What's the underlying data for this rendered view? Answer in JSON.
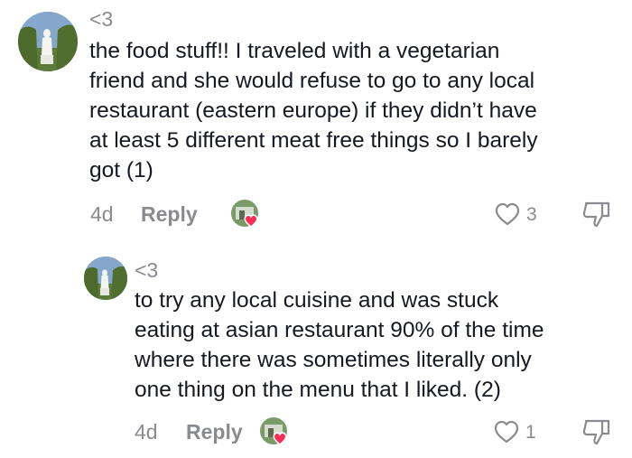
{
  "comments": [
    {
      "username": "<3",
      "text": "the food stuff!! I traveled with a vegetarian friend and she would refuse to go to any local restaurant (eastern europe) if they didn’t have at least 5 different meat free things so I barely got (1)",
      "lines": [
        "the food stuff!! I traveled with a vegetarian",
        "friend and she would refuse to go to any local",
        "restaurant (eastern europe) if they didn’t have",
        "at least 5 different meat free things so I barely",
        "got (1)"
      ],
      "age": "4d",
      "reply_label": "Reply",
      "like_count": "3",
      "icons": {
        "like": "heart-outline-icon",
        "dislike": "thumbs-down-icon",
        "liked_by": "heart-icon"
      }
    },
    {
      "username": "<3",
      "text": "to try any local cuisine and was stuck eating at asian restaurant 90% of the time where there was sometimes literally only one thing on the menu that I liked. (2)",
      "lines": [
        "to try any local cuisine and was stuck",
        "eating at asian restaurant 90% of the time",
        "where there was sometimes literally only",
        "one thing on the menu that I liked. (2)"
      ],
      "age": "4d",
      "reply_label": "Reply",
      "like_count": "1",
      "icons": {
        "like": "heart-outline-icon",
        "dislike": "thumbs-down-icon",
        "liked_by": "heart-icon"
      }
    }
  ],
  "colors": {
    "text": "#161823",
    "muted": "#8a8b91",
    "heart": "#fe2c55"
  }
}
